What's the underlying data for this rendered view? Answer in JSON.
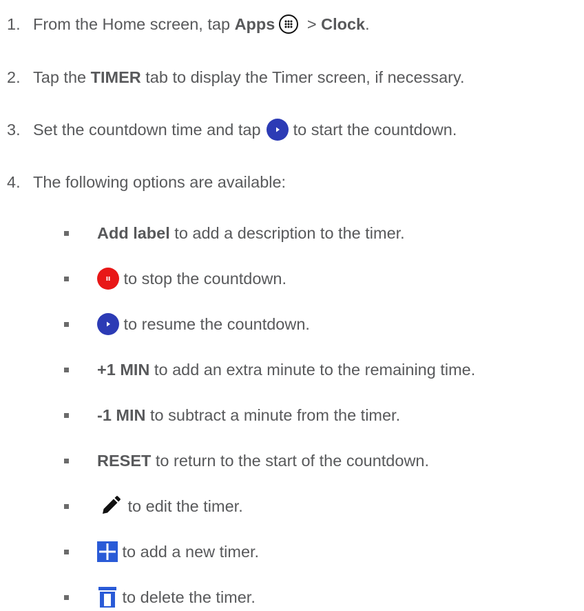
{
  "steps": [
    {
      "num": "1.",
      "t1": "From the Home screen, tap ",
      "b1": "Apps",
      "t2": " > ",
      "b2": "Clock",
      "t3": "."
    },
    {
      "num": "2.",
      "t1": "Tap the ",
      "b1": "TIMER",
      "t2": " tab to display the Timer screen, if necessary."
    },
    {
      "num": "3.",
      "t1": "Set the countdown time and tap ",
      "t2": " to start the countdown."
    },
    {
      "num": "4.",
      "t1": "The following options are available:"
    }
  ],
  "options": [
    {
      "bold": "Add label",
      "text": " to add a description to the timer."
    },
    {
      "icon": "pause-icon",
      "text": " to stop the countdown."
    },
    {
      "icon": "play-icon",
      "text": " to resume the countdown."
    },
    {
      "bold": "+1 MIN",
      "text": " to add an extra minute to the remaining time."
    },
    {
      "bold": "-1 MIN",
      "text": " to subtract a minute from the timer."
    },
    {
      "bold": "RESET",
      "text": " to return to the start of the countdown."
    },
    {
      "icon": "pencil-icon",
      "text": " to edit the timer."
    },
    {
      "icon": "plus-icon",
      "text": " to add a new timer."
    },
    {
      "icon": "trash-icon",
      "text": " to delete the timer."
    }
  ],
  "colors": {
    "text": "#58595b",
    "play_button": "#2c3bb5",
    "pause_button": "#e81717",
    "add_icon": "#2a5bd7"
  },
  "icons": [
    "apps-icon",
    "play-icon",
    "pause-icon",
    "pencil-icon",
    "plus-icon",
    "trash-icon"
  ]
}
